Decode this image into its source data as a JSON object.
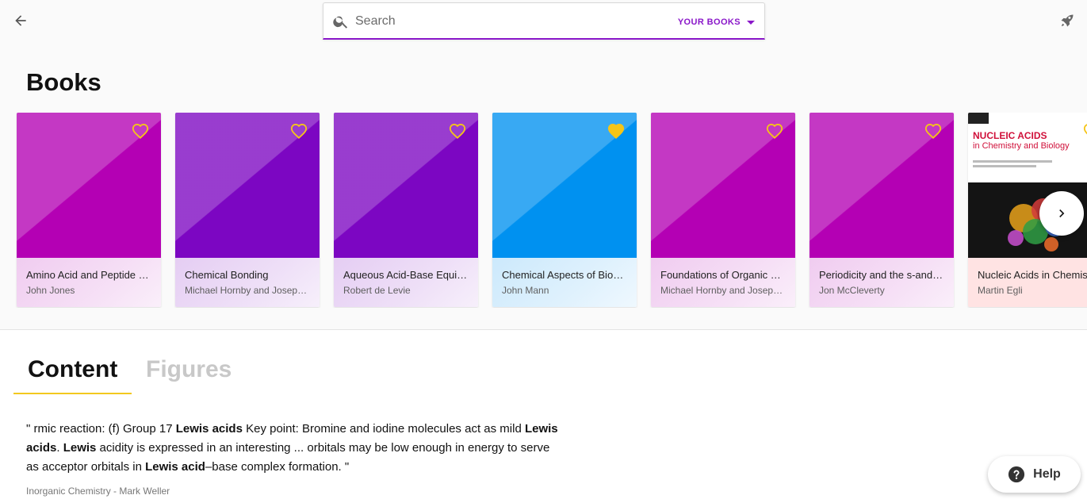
{
  "search": {
    "placeholder": "Search",
    "scope_label": "YOUR BOOKS"
  },
  "books_section": {
    "title": "Books",
    "items": [
      {
        "title": "Amino Acid and Peptide Synthesis",
        "author": "John Jones",
        "color": "#b400b4",
        "favorite": false
      },
      {
        "title": "Chemical Bonding",
        "author": "Michael Hornby and Joseph Peach",
        "color": "#7c06c2",
        "favorite": false
      },
      {
        "title": "Aqueous Acid-Base Equilibrium",
        "author": "Robert de Levie",
        "color": "#7c06c2",
        "favorite": false
      },
      {
        "title": "Chemical Aspects of Biosynthesis",
        "author": "John Mann",
        "color": "#0091f0",
        "favorite": true
      },
      {
        "title": "Foundations of Organic Chemistry",
        "author": "Michael Hornby and Joseph Peach",
        "color": "#b400b4",
        "favorite": false
      },
      {
        "title": "Periodicity and the s-and p-Block Elements",
        "author": "Jon McCleverty",
        "color": "#b400b4",
        "favorite": false
      },
      {
        "title": "Nucleic Acids in Chemistry and Biology",
        "author": "Martin Egli",
        "color": "#ffe3e3",
        "favorite": false,
        "cover": {
          "line1": "NUCLEIC ACIDS",
          "line2": "in Chemistry and Biology"
        }
      }
    ]
  },
  "tabs": [
    {
      "label": "Content",
      "active": true
    },
    {
      "label": "Figures",
      "active": false
    }
  ],
  "result": {
    "segments": [
      {
        "text": "\" rmic reaction: (f) Group 17 ",
        "bold": false
      },
      {
        "text": "Lewis acids",
        "bold": true
      },
      {
        "text": " Key point: Bromine and iodine molecules act as mild ",
        "bold": false
      },
      {
        "text": "Lewis acids",
        "bold": true
      },
      {
        "text": ". ",
        "bold": false
      },
      {
        "text": "Lewis",
        "bold": true
      },
      {
        "text": " acidity is expressed in an interesting ... orbitals may be low enough in energy to serve as acceptor orbitals in ",
        "bold": false
      },
      {
        "text": "Lewis acid",
        "bold": true
      },
      {
        "text": "–base complex formation. \"",
        "bold": false
      }
    ],
    "source": "Inorganic Chemistry - Mark Weller"
  },
  "help": {
    "label": "Help"
  },
  "colors": {
    "accent": "#8a17c9",
    "favorite": "#f5c518",
    "tab_indicator": "#f2c81e"
  }
}
